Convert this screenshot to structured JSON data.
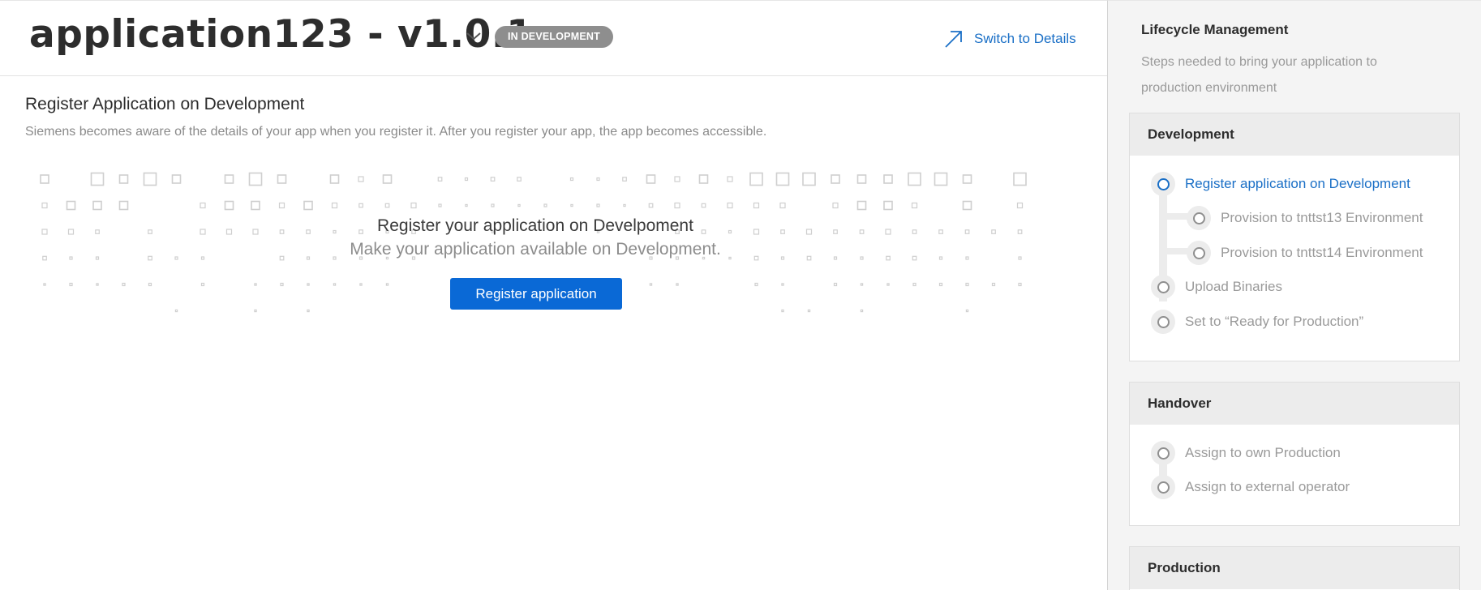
{
  "header": {
    "app_title": "application123 - v1.0.1",
    "status_badge": "IN DEVELOPMENT",
    "switch_link": "Switch to Details"
  },
  "main": {
    "section_title": "Register Application on Development",
    "section_desc": "Siemens becomes aware of the details of your app when you register it. After you register your app, the app becomes accessible.",
    "empty_title": "Register your application on Develpoment",
    "empty_sub": "Make your application available on Development.",
    "register_button": "Register application"
  },
  "sidebar": {
    "title": "Lifecycle Management",
    "description": "Steps needed to bring your application to production environment",
    "stages": [
      {
        "title": "Development",
        "steps": [
          {
            "label": "Register application on Development",
            "state": "active"
          },
          {
            "label": "Provision to tnttst13 Environment",
            "state": "pending"
          },
          {
            "label": "Provision to tnttst14 Environment",
            "state": "pending"
          },
          {
            "label": "Upload Binaries",
            "state": "pending"
          },
          {
            "label": "Set to “Ready for Production”",
            "state": "pending"
          }
        ]
      },
      {
        "title": "Handover",
        "steps": [
          {
            "label": "Assign to own Production",
            "state": "pending"
          },
          {
            "label": "Assign to external operator",
            "state": "pending"
          }
        ]
      },
      {
        "title": "Production",
        "steps": []
      }
    ]
  },
  "colors": {
    "accent": "#1a6fc6",
    "primary_button": "#0a69d6",
    "badge": "#8e8e8e",
    "panel_bg": "#f4f4f4"
  },
  "icons": {
    "version_toggle": "chevron-down-icon",
    "switch_link": "arrow-up-right-icon",
    "step_marker": "circle-outline-icon"
  }
}
